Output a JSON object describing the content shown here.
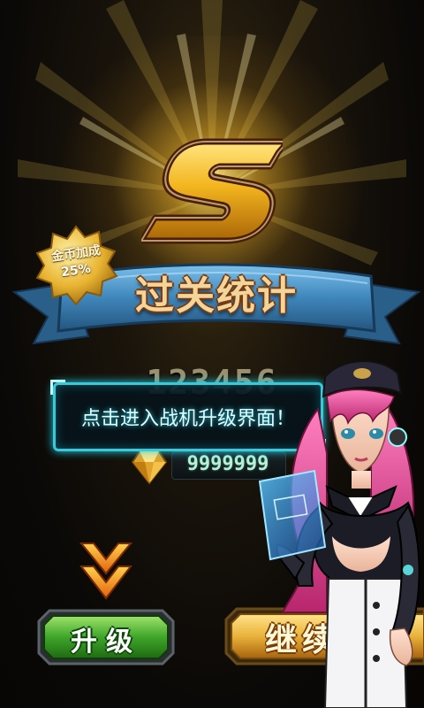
{
  "grade": {
    "letter": "S"
  },
  "bonus_medal": {
    "label": "金币加成",
    "value": "25%"
  },
  "ribbon": {
    "title": "过关统计"
  },
  "stats": {
    "score": "123456",
    "coins": "9999999"
  },
  "tooltip": {
    "text": "点击进入战机升级界面！"
  },
  "buttons": {
    "upgrade_label": "升级",
    "continue_label": "继续"
  },
  "colors": {
    "glow": "#f0b428",
    "ribbon_blue": "#4a8fbf",
    "tooltip_border": "#37c9dc",
    "upgrade_green": "#3ea52a",
    "continue_gold": "#e9b23a"
  },
  "icons": {
    "grade": "gold-s-grade-icon",
    "medal": "gold-seal-medal-icon",
    "gem": "gold-gem-icon",
    "arrows": "double-chevron-down-icon",
    "character": "pilot-girl-illustration"
  }
}
